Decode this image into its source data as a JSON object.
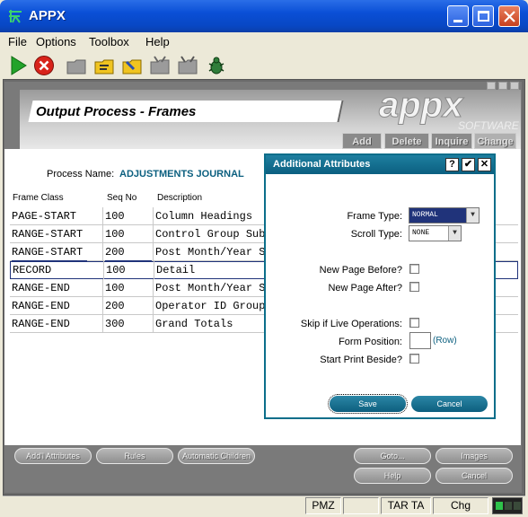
{
  "window": {
    "title": "APPX"
  },
  "menu": [
    "File",
    "Options",
    "Toolbox",
    "Help"
  ],
  "header": {
    "title": "Output Process - Frames",
    "logo_text": "appx",
    "logo_sub": "SOFTWARE",
    "buttons": [
      "Add",
      "Delete",
      "Inquire",
      "Change"
    ]
  },
  "form": {
    "process_label": "Process Name:",
    "process_value": "ADJUSTMENTS JOURNAL"
  },
  "table": {
    "headers": [
      "Frame Class",
      "Seq No",
      "Description"
    ],
    "rows": [
      [
        "PAGE-START",
        "100",
        "Column Headings"
      ],
      [
        "RANGE-START",
        "100",
        "Control Group Sub"
      ],
      [
        "RANGE-START",
        "200",
        "Post Month/Year S"
      ],
      [
        "RECORD",
        "100",
        "Detail"
      ],
      [
        "RANGE-END",
        "100",
        "Post Month/Year S"
      ],
      [
        "RANGE-END",
        "200",
        "Operator ID Group"
      ],
      [
        "RANGE-END",
        "300",
        "Grand Totals"
      ]
    ]
  },
  "bottom_buttons": {
    "add_attributes": "Add'l Attributes",
    "rules": "Rules",
    "automatic_children": "Automatic Children",
    "goto": "Goto...",
    "images": "Images",
    "help": "Help",
    "cancel": "Cancel"
  },
  "status": {
    "c1": "PMZ",
    "c2": "TAR TA",
    "c3": "Chg"
  },
  "dialog": {
    "title": "Additional Attributes",
    "frame_type_label": "Frame Type:",
    "frame_type_value": "NORMAL",
    "scroll_type_label": "Scroll Type:",
    "scroll_type_value": "NONE",
    "new_page_before_label": "New Page Before?",
    "new_page_after_label": "New Page After?",
    "skip_live_label": "Skip if Live Operations:",
    "form_position_label": "Form Position:",
    "form_position_unit": "(Row)",
    "start_print_beside_label": "Start Print Beside?",
    "save_label": "Save",
    "cancel_label": "Cancel",
    "help_glyph": "?",
    "ok_glyph": "✔",
    "close_glyph": "✕"
  }
}
